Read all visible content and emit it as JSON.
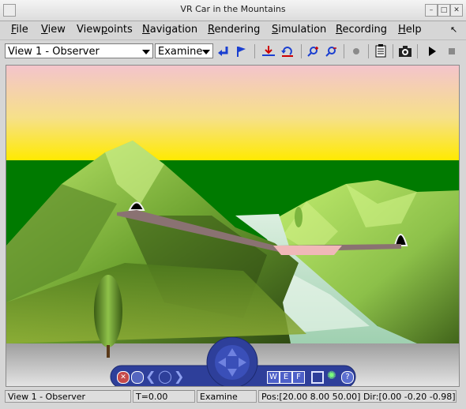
{
  "window": {
    "title": "VR Car in the Mountains"
  },
  "menubar": {
    "items": [
      {
        "id": "file",
        "label": "File",
        "mn": "F",
        "rest": "ile"
      },
      {
        "id": "view",
        "label": "View",
        "mn": "V",
        "rest": "iew"
      },
      {
        "id": "viewpoints",
        "label": "Viewpoints",
        "pre": "View",
        "mn": "p",
        "rest": "oints"
      },
      {
        "id": "navigation",
        "label": "Navigation",
        "mn": "N",
        "rest": "avigation"
      },
      {
        "id": "rendering",
        "label": "Rendering",
        "mn": "R",
        "rest": "endering"
      },
      {
        "id": "simulation",
        "label": "Simulation",
        "mn": "S",
        "rest": "imulation"
      },
      {
        "id": "recording",
        "label": "Recording",
        "mn": "R",
        "rest": "ecording"
      },
      {
        "id": "help",
        "label": "Help",
        "mn": "H",
        "rest": "elp"
      }
    ]
  },
  "toolbar": {
    "viewpoint_select": "View 1 - Observer",
    "navigation_select": "Examine"
  },
  "statusbar": {
    "viewpoint": "View 1 - Observer",
    "time": "T=0.00",
    "mode": "Examine",
    "position": "Pos:[20.00 8.00 50.00] Dir:[0.00 -0.20 -0.98]"
  },
  "navpanel": {
    "w_label": "W",
    "e_label": "E",
    "f_label": "F",
    "help_label": "?"
  },
  "colors": {
    "sky_top": "#f4c4cc",
    "sky_bottom": "#ffea00",
    "ground": "#007a00",
    "hill_light": "#a6d65a",
    "hill_dark": "#2f4a12",
    "road": "#8a7272",
    "river": "#bfe0c8",
    "navpanel": "#2e3f9a"
  }
}
